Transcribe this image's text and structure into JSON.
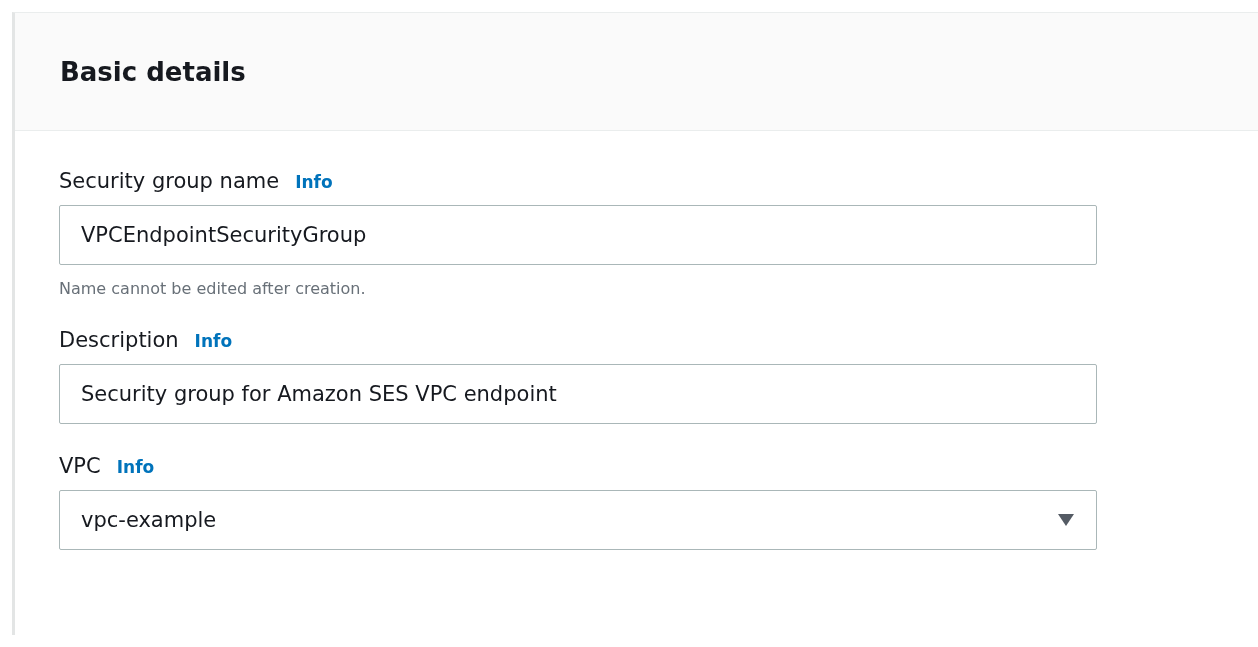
{
  "panel": {
    "title": "Basic details"
  },
  "fields": [
    {
      "kind": "text",
      "label": "Security group name",
      "info": "Info",
      "value": "VPCEndpointSecurityGroup",
      "hint": "Name cannot be edited after creation."
    },
    {
      "kind": "text",
      "label": "Description",
      "info": "Info",
      "value": "Security group for Amazon SES VPC endpoint"
    },
    {
      "kind": "select",
      "label": "VPC",
      "info": "Info",
      "value": "vpc-example"
    }
  ]
}
